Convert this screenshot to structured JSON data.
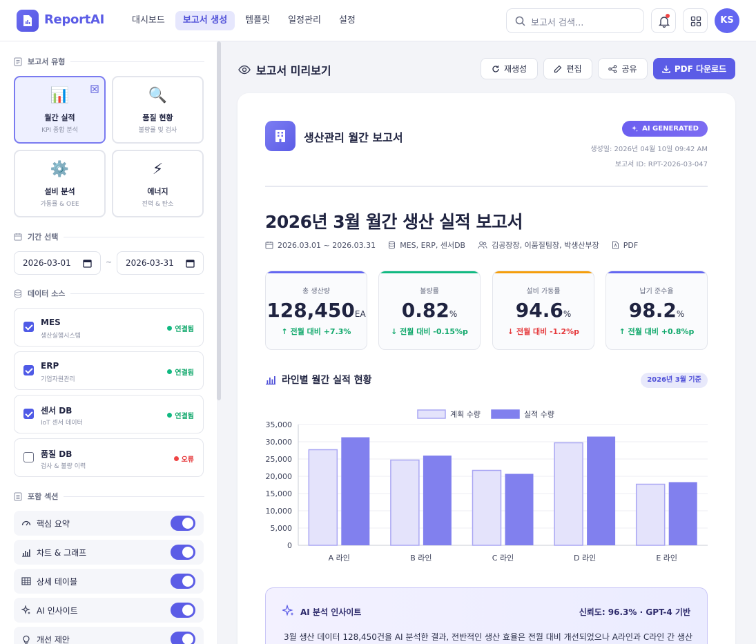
{
  "app": {
    "name": "ReportAI"
  },
  "nav": [
    {
      "label": "대시보드",
      "active": false
    },
    {
      "label": "보고서 생성",
      "active": true
    },
    {
      "label": "템플릿",
      "active": false
    },
    {
      "label": "일정관리",
      "active": false
    },
    {
      "label": "설정",
      "active": false
    }
  ],
  "search": {
    "placeholder": "보고서 검색..."
  },
  "user": {
    "initials": "KS"
  },
  "sidebar": {
    "report_type_title": "보고서 유형",
    "report_types": [
      {
        "title": "월간 실적",
        "subtitle": "KPI 종합 분석",
        "icon": "bar-chart-icon",
        "selected": true
      },
      {
        "title": "품질 현황",
        "subtitle": "불량률 및 검사",
        "icon": "magnifier-icon",
        "selected": false
      },
      {
        "title": "설비 분석",
        "subtitle": "가동률 & OEE",
        "icon": "gear-icon",
        "selected": false
      },
      {
        "title": "에너지",
        "subtitle": "전력 & 탄소",
        "icon": "lightning-icon",
        "selected": false
      }
    ],
    "period_title": "기간 선택",
    "period": {
      "start": "2026-03-01",
      "end": "2026-03-31",
      "separator": "~"
    },
    "source_title": "데이터 소스",
    "sources": [
      {
        "name": "MES",
        "desc": "생산실행시스템",
        "checked": true,
        "status": "연결됨",
        "state": "ok"
      },
      {
        "name": "ERP",
        "desc": "기업자원관리",
        "checked": true,
        "status": "연결됨",
        "state": "ok"
      },
      {
        "name": "센서 DB",
        "desc": "IoT 센서 데이터",
        "checked": true,
        "status": "연결됨",
        "state": "ok"
      },
      {
        "name": "품질 DB",
        "desc": "검사 & 불량 이력",
        "checked": false,
        "status": "오류",
        "state": "error"
      }
    ],
    "sections_title": "포함 섹션",
    "sections": [
      {
        "label": "핵심 요약",
        "icon": "gauge-icon",
        "on": true
      },
      {
        "label": "차트 & 그래프",
        "icon": "bar-chart-icon",
        "on": true
      },
      {
        "label": "상세 테이블",
        "icon": "table-icon",
        "on": true
      },
      {
        "label": "AI 인사이트",
        "icon": "sparkle-icon",
        "on": true
      },
      {
        "label": "개선 제안",
        "icon": "lightbulb-icon",
        "on": true
      }
    ]
  },
  "preview": {
    "title": "보고서 미리보기",
    "actions": {
      "regenerate": "재생성",
      "edit": "편집",
      "share": "공유",
      "download": "PDF 다운로드"
    }
  },
  "report": {
    "doc_name": "생산관리 월간 보고서",
    "ai_badge": "AI GENERATED",
    "generated": "생성일: 2026년 04월 10일 09:42 AM",
    "report_id": "보고서 ID: RPT-2026-03-047",
    "title": "2026년 3월 월간 생산 실적 보고서",
    "meta": {
      "period": "2026.03.01 ~ 2026.03.31",
      "sources": "MES, ERP, 센서DB",
      "people": "김공장장, 이품질팀장, 박생산부장",
      "format": "PDF"
    },
    "kpis": [
      {
        "label": "총 생산량",
        "value": "128,450",
        "unit": "EA",
        "change": "↑ 전월 대비 +7.3%",
        "color": "#6366f1",
        "trend": "up"
      },
      {
        "label": "불량률",
        "value": "0.82",
        "unit": "%",
        "change": "↓ 전월 대비 -0.15%p",
        "color": "#10b981",
        "trend": "dn"
      },
      {
        "label": "설비 가동률",
        "value": "94.6",
        "unit": "%",
        "change": "↓ 전월 대비 -1.2%p",
        "color": "#f59e0b",
        "trend": "bad"
      },
      {
        "label": "납기 준수율",
        "value": "98.2",
        "unit": "%",
        "change": "↑ 전월 대비 +0.8%p",
        "color": "#6366f1",
        "trend": "up"
      }
    ],
    "chart_title": "라인별 월간 실적 현황",
    "chart_badge": "2026년 3월 기준",
    "ai_insight": {
      "title": "AI 분석 인사이트",
      "confidence": "신뢰도: 96.3% · GPT-4 기반",
      "body": "3월 생산 데이터 128,450건을 AI 분석한 결과, 전반적인 생산 효율은 전월 대비 개선되었으나 A라인과 C라인 간 생산"
    }
  },
  "chart_data": {
    "type": "bar",
    "categories": [
      "A 라인",
      "B 라인",
      "C 라인",
      "D 라인",
      "E 라인"
    ],
    "series": [
      {
        "name": "계획 수량",
        "values": [
          27700,
          24700,
          21700,
          29700,
          17700
        ],
        "color": "#e4e3fb",
        "stroke": "#a9a6f3"
      },
      {
        "name": "실적 수량",
        "values": [
          31300,
          26000,
          20700,
          31500,
          18300
        ],
        "color": "#8180ee",
        "stroke": "#8180ee"
      }
    ],
    "ylim": [
      0,
      35000
    ],
    "yticks": [
      0,
      5000,
      10000,
      15000,
      20000,
      25000,
      30000,
      35000
    ],
    "ytick_labels": [
      "0",
      "5,000",
      "10,000",
      "15,000",
      "20,000",
      "25,000",
      "30,000",
      "35,000"
    ],
    "legend": "top-center",
    "grid": true
  }
}
